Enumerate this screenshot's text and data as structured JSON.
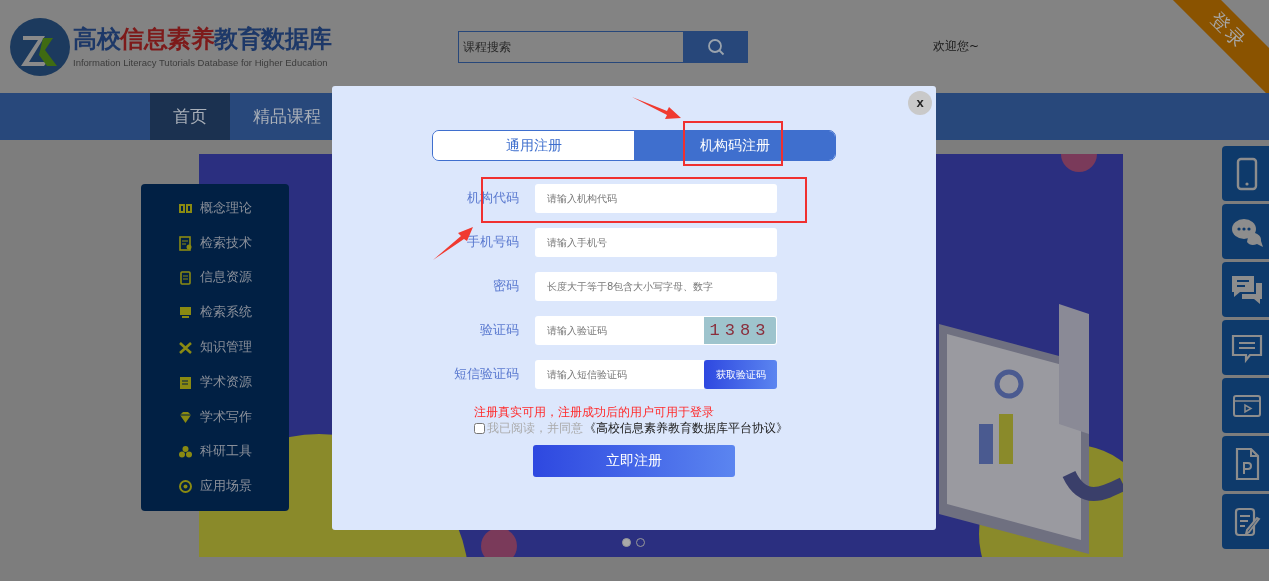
{
  "logo": {
    "title_parts": [
      {
        "text": "高校",
        "color": "#1d3868"
      },
      {
        "text": "信息素养",
        "color": "#7d1a1a"
      },
      {
        "text": "教育数据库",
        "color": "#1d3868"
      }
    ],
    "subtitle": "Information Literacy Tutorials Database for Higher Education"
  },
  "search": {
    "placeholder": "课程搜索"
  },
  "welcome": "欢迎您~",
  "login_ribbon": "登录",
  "nav": [
    {
      "label": "首页",
      "selected": true
    },
    {
      "label": "精品课程",
      "selected": false
    }
  ],
  "sidebar": {
    "items": [
      "概念理论",
      "检索技术",
      "信息资源",
      "检索系统",
      "知识管理",
      "学术资源",
      "学术写作",
      "科研工具",
      "应用场景"
    ]
  },
  "carousel": {
    "dots": [
      {
        "selected": true
      },
      {
        "selected": false
      }
    ]
  },
  "modal": {
    "close": "x",
    "tabs": [
      {
        "label": "通用注册",
        "selected": false
      },
      {
        "label": "机构码注册",
        "selected": true
      }
    ],
    "fields": [
      {
        "kind": "text",
        "label": "机构代码",
        "placeholder": "请输入机构代码"
      },
      {
        "kind": "text",
        "label": "手机号码",
        "placeholder": "请输入手机号"
      },
      {
        "kind": "text",
        "label": "密码",
        "placeholder": "长度大于等于8包含大小写字母、数字"
      },
      {
        "kind": "captcha",
        "label": "验证码",
        "placeholder": "请输入验证码",
        "captcha": "1383"
      },
      {
        "kind": "sms",
        "label": "短信验证码",
        "placeholder": "请输入短信验证码",
        "button": "获取验证码"
      }
    ],
    "notice": "注册真实可用，注册成功后的用户可用于登录",
    "agreement": {
      "checked": false,
      "text": "我已阅读，并同意",
      "link": "《高校信息素养教育数据库平台协议》"
    },
    "submit": "立即注册"
  }
}
